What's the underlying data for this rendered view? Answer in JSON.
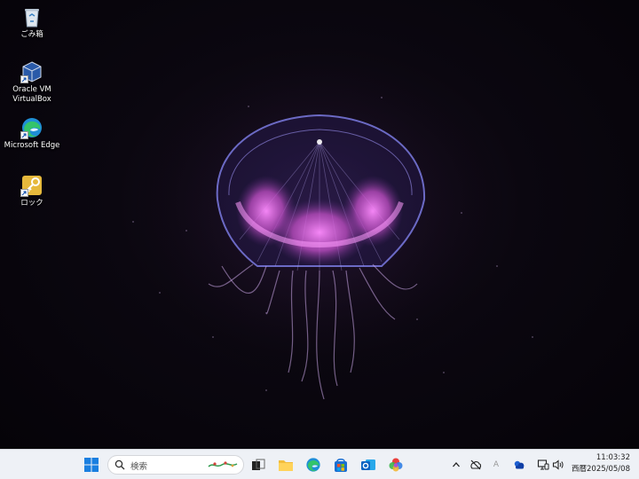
{
  "desktop": {
    "icons": [
      {
        "name": "recycle-bin",
        "label": "ごみ箱"
      },
      {
        "name": "oracle-vm-virtualbox",
        "label": "Oracle VM\nVirtualBox"
      },
      {
        "name": "microsoft-edge",
        "label": "Microsoft Edge"
      },
      {
        "name": "lock",
        "label": "ロック"
      }
    ]
  },
  "taskbar": {
    "search_placeholder": "検索",
    "apps": [
      "start-icon",
      "task-view-icon",
      "file-explorer-icon",
      "edge-icon",
      "store-icon",
      "outlook-icon",
      "colorful-app-icon"
    ],
    "tray": [
      "chevron-up-icon",
      "network-off-icon",
      "ime-icon",
      "onedrive-icon",
      "display-icon",
      "speaker-icon"
    ],
    "ime_label": "A",
    "time": "11:03:32",
    "date": "西暦2025/05/08"
  },
  "colors": {
    "taskbar_bg": "#eef1f6",
    "accent": "#0067c0",
    "jelly_bell": "#6d6cd8",
    "jelly_glow": "#d56ad6"
  }
}
